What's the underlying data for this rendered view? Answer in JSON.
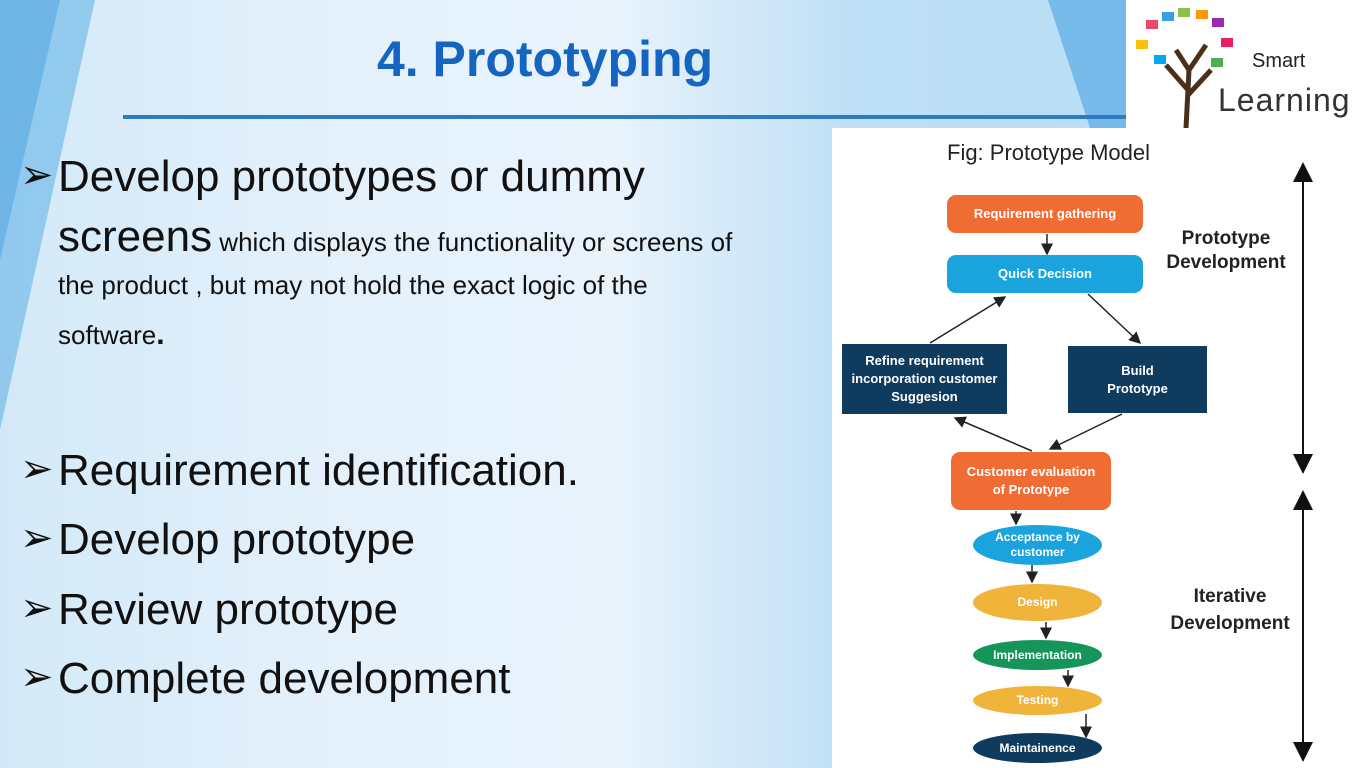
{
  "slide": {
    "title": "4. Prototyping",
    "accent_color": "#1565c0"
  },
  "logo": {
    "line1": "Smart",
    "line2": "Learning"
  },
  "bullets": {
    "main": {
      "lead_line1": "Develop prototypes or dummy",
      "lead_word": "screens",
      "rest_line1": " which displays the functionality or screens of",
      "rest_line2": "the product , but may not hold the exact logic of the",
      "rest_line3": "software",
      "period": "."
    },
    "steps": [
      "Requirement identification.",
      "Develop prototype",
      "Review prototype",
      "Complete development"
    ],
    "marker": "➢"
  },
  "figure": {
    "caption": "Fig:  Prototype Model",
    "nodes": {
      "requirement_gathering": "Requirement gathering",
      "quick_decision": "Quick Decision",
      "refine": [
        "Refine requirement",
        "incorporation customer",
        "Suggesion"
      ],
      "build": [
        "Build",
        "Prototype"
      ],
      "customer_eval": [
        "Customer evaluation",
        "of Prototype"
      ],
      "acceptance": [
        "Acceptance by",
        "customer"
      ],
      "design": "Design",
      "implementation": "Implementation",
      "testing": "Testing",
      "maintainence": "Maintainence"
    },
    "labels": {
      "prototype_dev": [
        "Prototype",
        "Development"
      ],
      "iterative_dev": [
        "Iterative",
        "Development"
      ]
    },
    "colors": {
      "orange": "#ef6c35",
      "blue": "#1aa3dc",
      "navy": "#0f3b5e",
      "yellow": "#f0b43a",
      "green": "#16955a"
    }
  }
}
